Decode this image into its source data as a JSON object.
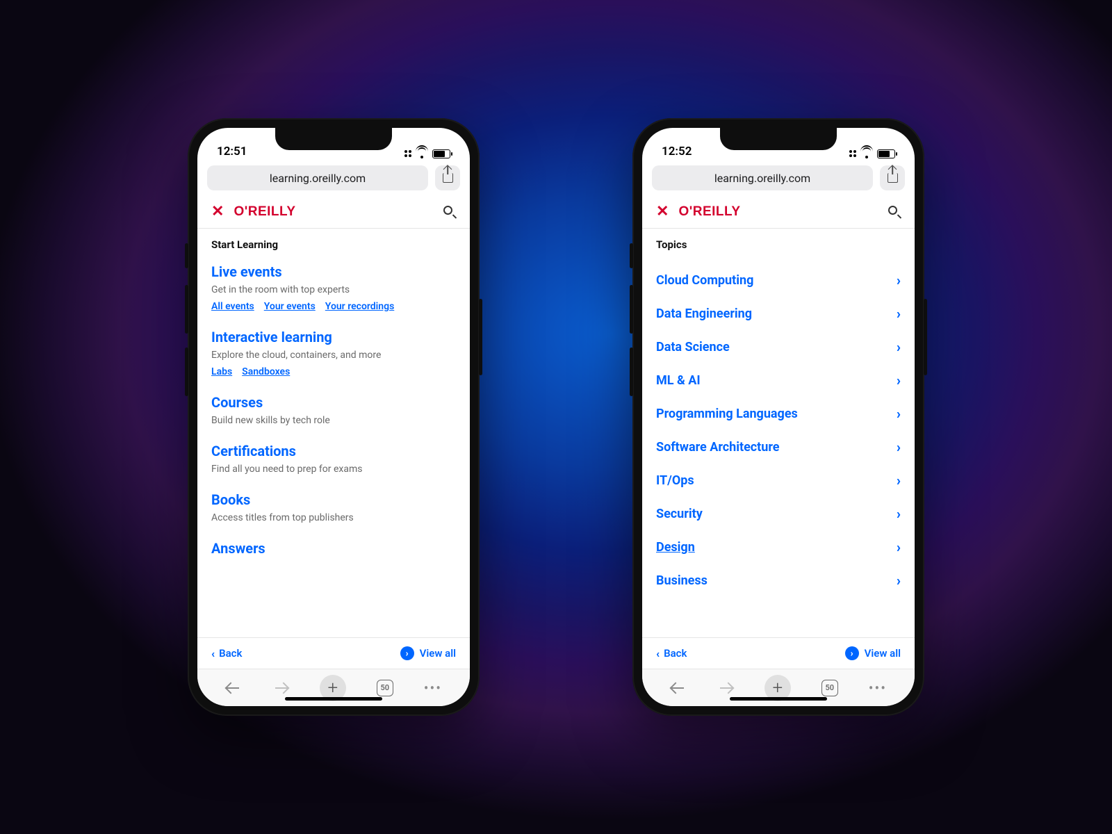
{
  "status": {
    "time_left": "12:51",
    "time_right": "12:52"
  },
  "address_bar": {
    "url": "learning.oreilly.com"
  },
  "app_header": {
    "logo_pre": "O",
    "logo_apos": "'",
    "logo_post": "REILLY"
  },
  "left_screen": {
    "section_title": "Start Learning",
    "categories": [
      {
        "title": "Live events",
        "desc": "Get in the room with top experts",
        "links": [
          "All events",
          "Your events",
          "Your recordings"
        ]
      },
      {
        "title": "Interactive learning",
        "desc": "Explore the cloud, containers, and more",
        "links": [
          "Labs",
          "Sandboxes"
        ]
      },
      {
        "title": "Courses",
        "desc": "Build new skills by tech role",
        "links": []
      },
      {
        "title": "Certifications",
        "desc": "Find all you need to prep for exams",
        "links": []
      },
      {
        "title": "Books",
        "desc": "Access titles from top publishers",
        "links": []
      },
      {
        "title": "Answers",
        "desc": "",
        "links": []
      }
    ]
  },
  "right_screen": {
    "section_title": "Topics",
    "topics": [
      {
        "label": "Cloud Computing"
      },
      {
        "label": "Data Engineering"
      },
      {
        "label": "Data Science"
      },
      {
        "label": "ML & AI"
      },
      {
        "label": "Programming Languages"
      },
      {
        "label": "Software Architecture"
      },
      {
        "label": "IT/Ops"
      },
      {
        "label": "Security"
      },
      {
        "label": "Design",
        "underline": true
      },
      {
        "label": "Business"
      }
    ]
  },
  "bottom_nav": {
    "back": "Back",
    "view_all": "View all"
  },
  "browser": {
    "tab_count": "50"
  }
}
